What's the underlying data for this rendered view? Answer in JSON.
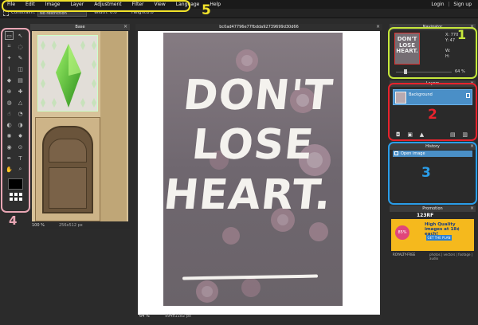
{
  "menubar": {
    "items": [
      "File",
      "Edit",
      "Image",
      "Layer",
      "Adjustment",
      "Filter",
      "View",
      "Language",
      "Help"
    ],
    "login": "Login",
    "signup": "Sign up",
    "separator": "|"
  },
  "options": {
    "constraint_label": "Constraint:",
    "constraint_value": "No restriction",
    "width_label": "Width:",
    "width_value": "0.0",
    "height_label": "Height:",
    "height_value": "0.0"
  },
  "base_panel": {
    "title": "Base",
    "zoom": "100",
    "zoom_unit": "%",
    "dimensions": "256x512 px"
  },
  "canvas": {
    "title": "bc0ad47796e77fbdda92739699d30d66",
    "zoom": "64",
    "zoom_unit": "%",
    "dimensions": "994x1182 px",
    "poster_lines": [
      "DON'T",
      "LOSE",
      "HEART."
    ]
  },
  "navigator": {
    "title": "Navigator",
    "x_label": "X:",
    "x_value": "770",
    "y_label": "Y:",
    "y_value": "47",
    "w_label": "W:",
    "h_label": "H:",
    "zoom": "64",
    "zoom_unit": "%",
    "thumb_lines": [
      "DON'T",
      "LOSE",
      "HEART."
    ]
  },
  "layers": {
    "title": "Layers",
    "items": [
      {
        "name": "Background"
      }
    ]
  },
  "history": {
    "title": "History",
    "items": [
      {
        "name": "Open image"
      }
    ]
  },
  "promotion": {
    "title": "Promotion",
    "brand": "123RF",
    "headline": "High Quality images at 18¢ each!",
    "cta": "GET THE PLAN",
    "discount": "85%",
    "footer_left": "ROYALTY-FREE",
    "footer_right": "photos | vectors | footage | audio"
  },
  "annotations": {
    "n1": "1",
    "n2": "2",
    "n3": "3",
    "n4": "4",
    "n5": "5",
    "colors": {
      "n1": "#c6e83c",
      "n2": "#e8232d",
      "n3": "#2a9de8",
      "n4": "#e8a6b4",
      "n5": "#f2e32a"
    }
  }
}
